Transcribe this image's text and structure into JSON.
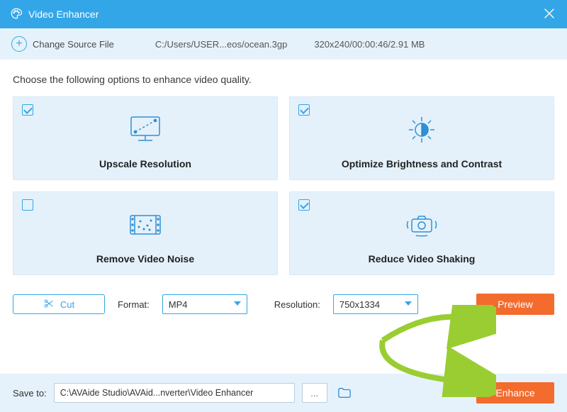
{
  "titlebar": {
    "title": "Video Enhancer"
  },
  "source": {
    "change_label": "Change Source File",
    "path": "C:/Users/USER...eos/ocean.3gp",
    "meta": "320x240/00:00:46/2.91 MB"
  },
  "instruction": "Choose the following options to enhance video quality.",
  "options": [
    {
      "label": "Upscale Resolution",
      "checked": true
    },
    {
      "label": "Optimize Brightness and Contrast",
      "checked": true
    },
    {
      "label": "Remove Video Noise",
      "checked": false
    },
    {
      "label": "Reduce Video Shaking",
      "checked": true
    }
  ],
  "controls": {
    "cut_label": "Cut",
    "format_label": "Format:",
    "format_value": "MP4",
    "resolution_label": "Resolution:",
    "resolution_value": "750x1334",
    "preview_label": "Preview"
  },
  "save": {
    "label": "Save to:",
    "path": "C:\\AVAide Studio\\AVAid...nverter\\Video Enhancer",
    "browse": "...",
    "enhance_label": "Enhance"
  },
  "colors": {
    "accent": "#33a6e8",
    "orange": "#f36b2d",
    "panel": "#e6f2fb"
  }
}
